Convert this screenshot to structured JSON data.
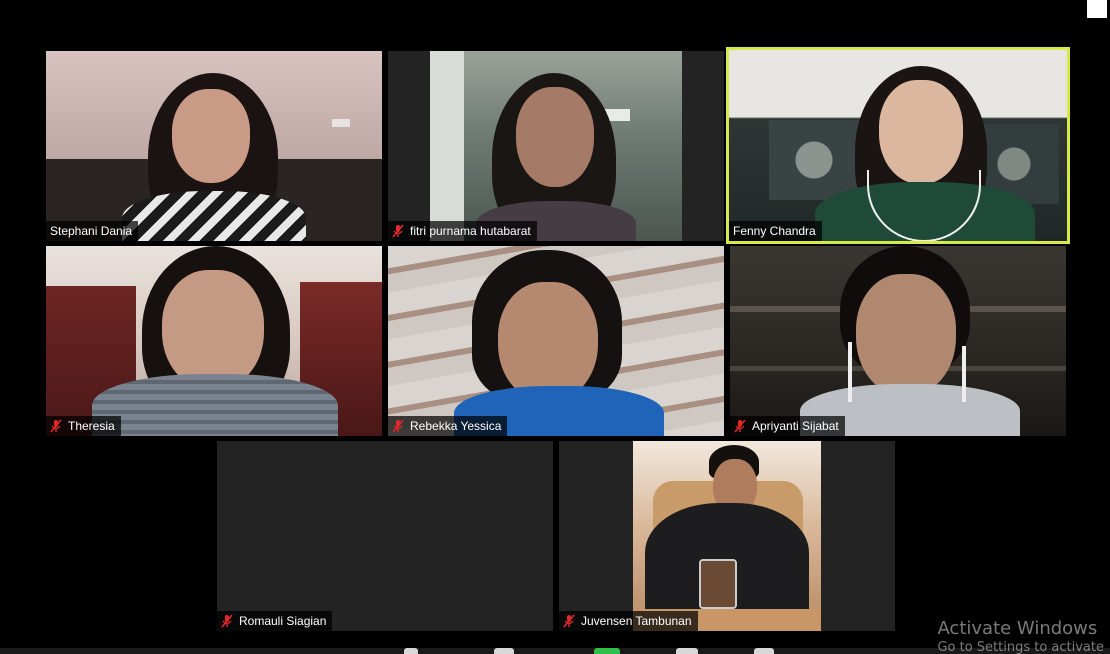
{
  "participants": [
    {
      "name": "Stephani Dania",
      "muted": false,
      "active": false
    },
    {
      "name": "fitri purnama hutabarat",
      "muted": true,
      "active": false
    },
    {
      "name": "Fenny Chandra",
      "muted": false,
      "active": true
    },
    {
      "name": "Theresia",
      "muted": true,
      "active": false
    },
    {
      "name": "Rebekka Yessica",
      "muted": true,
      "active": false
    },
    {
      "name": "Apriyanti Sijabat",
      "muted": true,
      "active": false
    },
    {
      "name": "Romauli Siagian",
      "muted": true,
      "active": false,
      "video_off": true
    },
    {
      "name": "Juvensen Tambunan",
      "muted": true,
      "active": false
    }
  ],
  "watermark": {
    "line1": "Activate Windows",
    "line2": "Go to Settings to activate"
  },
  "colors": {
    "active_border": "#d7e84a",
    "mute_icon": "#e02a2a",
    "tile_bg": "#232323"
  }
}
